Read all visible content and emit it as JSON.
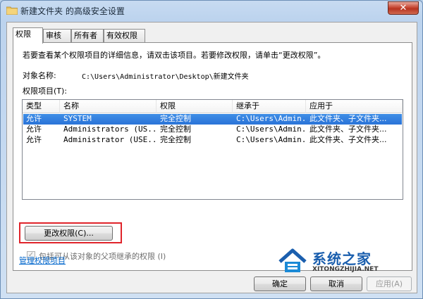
{
  "window": {
    "title": "新建文件夹 的高级安全设置",
    "close_symbol": "✕"
  },
  "tabs": [
    {
      "label": "权限",
      "active": true
    },
    {
      "label": "审核",
      "active": false
    },
    {
      "label": "所有者",
      "active": false
    },
    {
      "label": "有效权限",
      "active": false
    }
  ],
  "panel": {
    "instruction": "若要查看某个权限项目的详细信息，请双击该项目。若要修改权限，请单击“更改权限”。",
    "object_name_label": "对象名称:",
    "object_name_value": "C:\\Users\\Administrator\\Desktop\\新建文件夹",
    "entries_label": "权限项目(T):"
  },
  "permissions_table": {
    "columns": [
      "类型",
      "名称",
      "权限",
      "继承于",
      "应用于"
    ],
    "rows": [
      {
        "type": "允许",
        "name": "SYSTEM",
        "permission": "完全控制",
        "inherited_from": "C:\\Users\\Admin...",
        "applies_to": "此文件夹、子文件夹...",
        "selected": true
      },
      {
        "type": "允许",
        "name": "Administrators (US...",
        "permission": "完全控制",
        "inherited_from": "C:\\Users\\Admin...",
        "applies_to": "此文件夹、子文件夹...",
        "selected": false
      },
      {
        "type": "允许",
        "name": "Administrator (USE...",
        "permission": "完全控制",
        "inherited_from": "C:\\Users\\Admin...",
        "applies_to": "此文件夹、子文件夹...",
        "selected": false
      }
    ]
  },
  "change_permissions_button": "更改权限(C)...",
  "inherit_checkbox": {
    "label": "包括可从该对象的父项继承的权限 (I)",
    "checked": true,
    "disabled": true
  },
  "manage_link": "管理权限项目",
  "footer_buttons": {
    "ok": "确定",
    "cancel": "取消",
    "apply": "应用(A)"
  },
  "watermark": {
    "name": "系统之家",
    "url": "XITONGZHIJIA.NET"
  },
  "colors": {
    "selection": "#2a73d8",
    "highlight_box": "#e0242b",
    "link": "#0066cc"
  }
}
